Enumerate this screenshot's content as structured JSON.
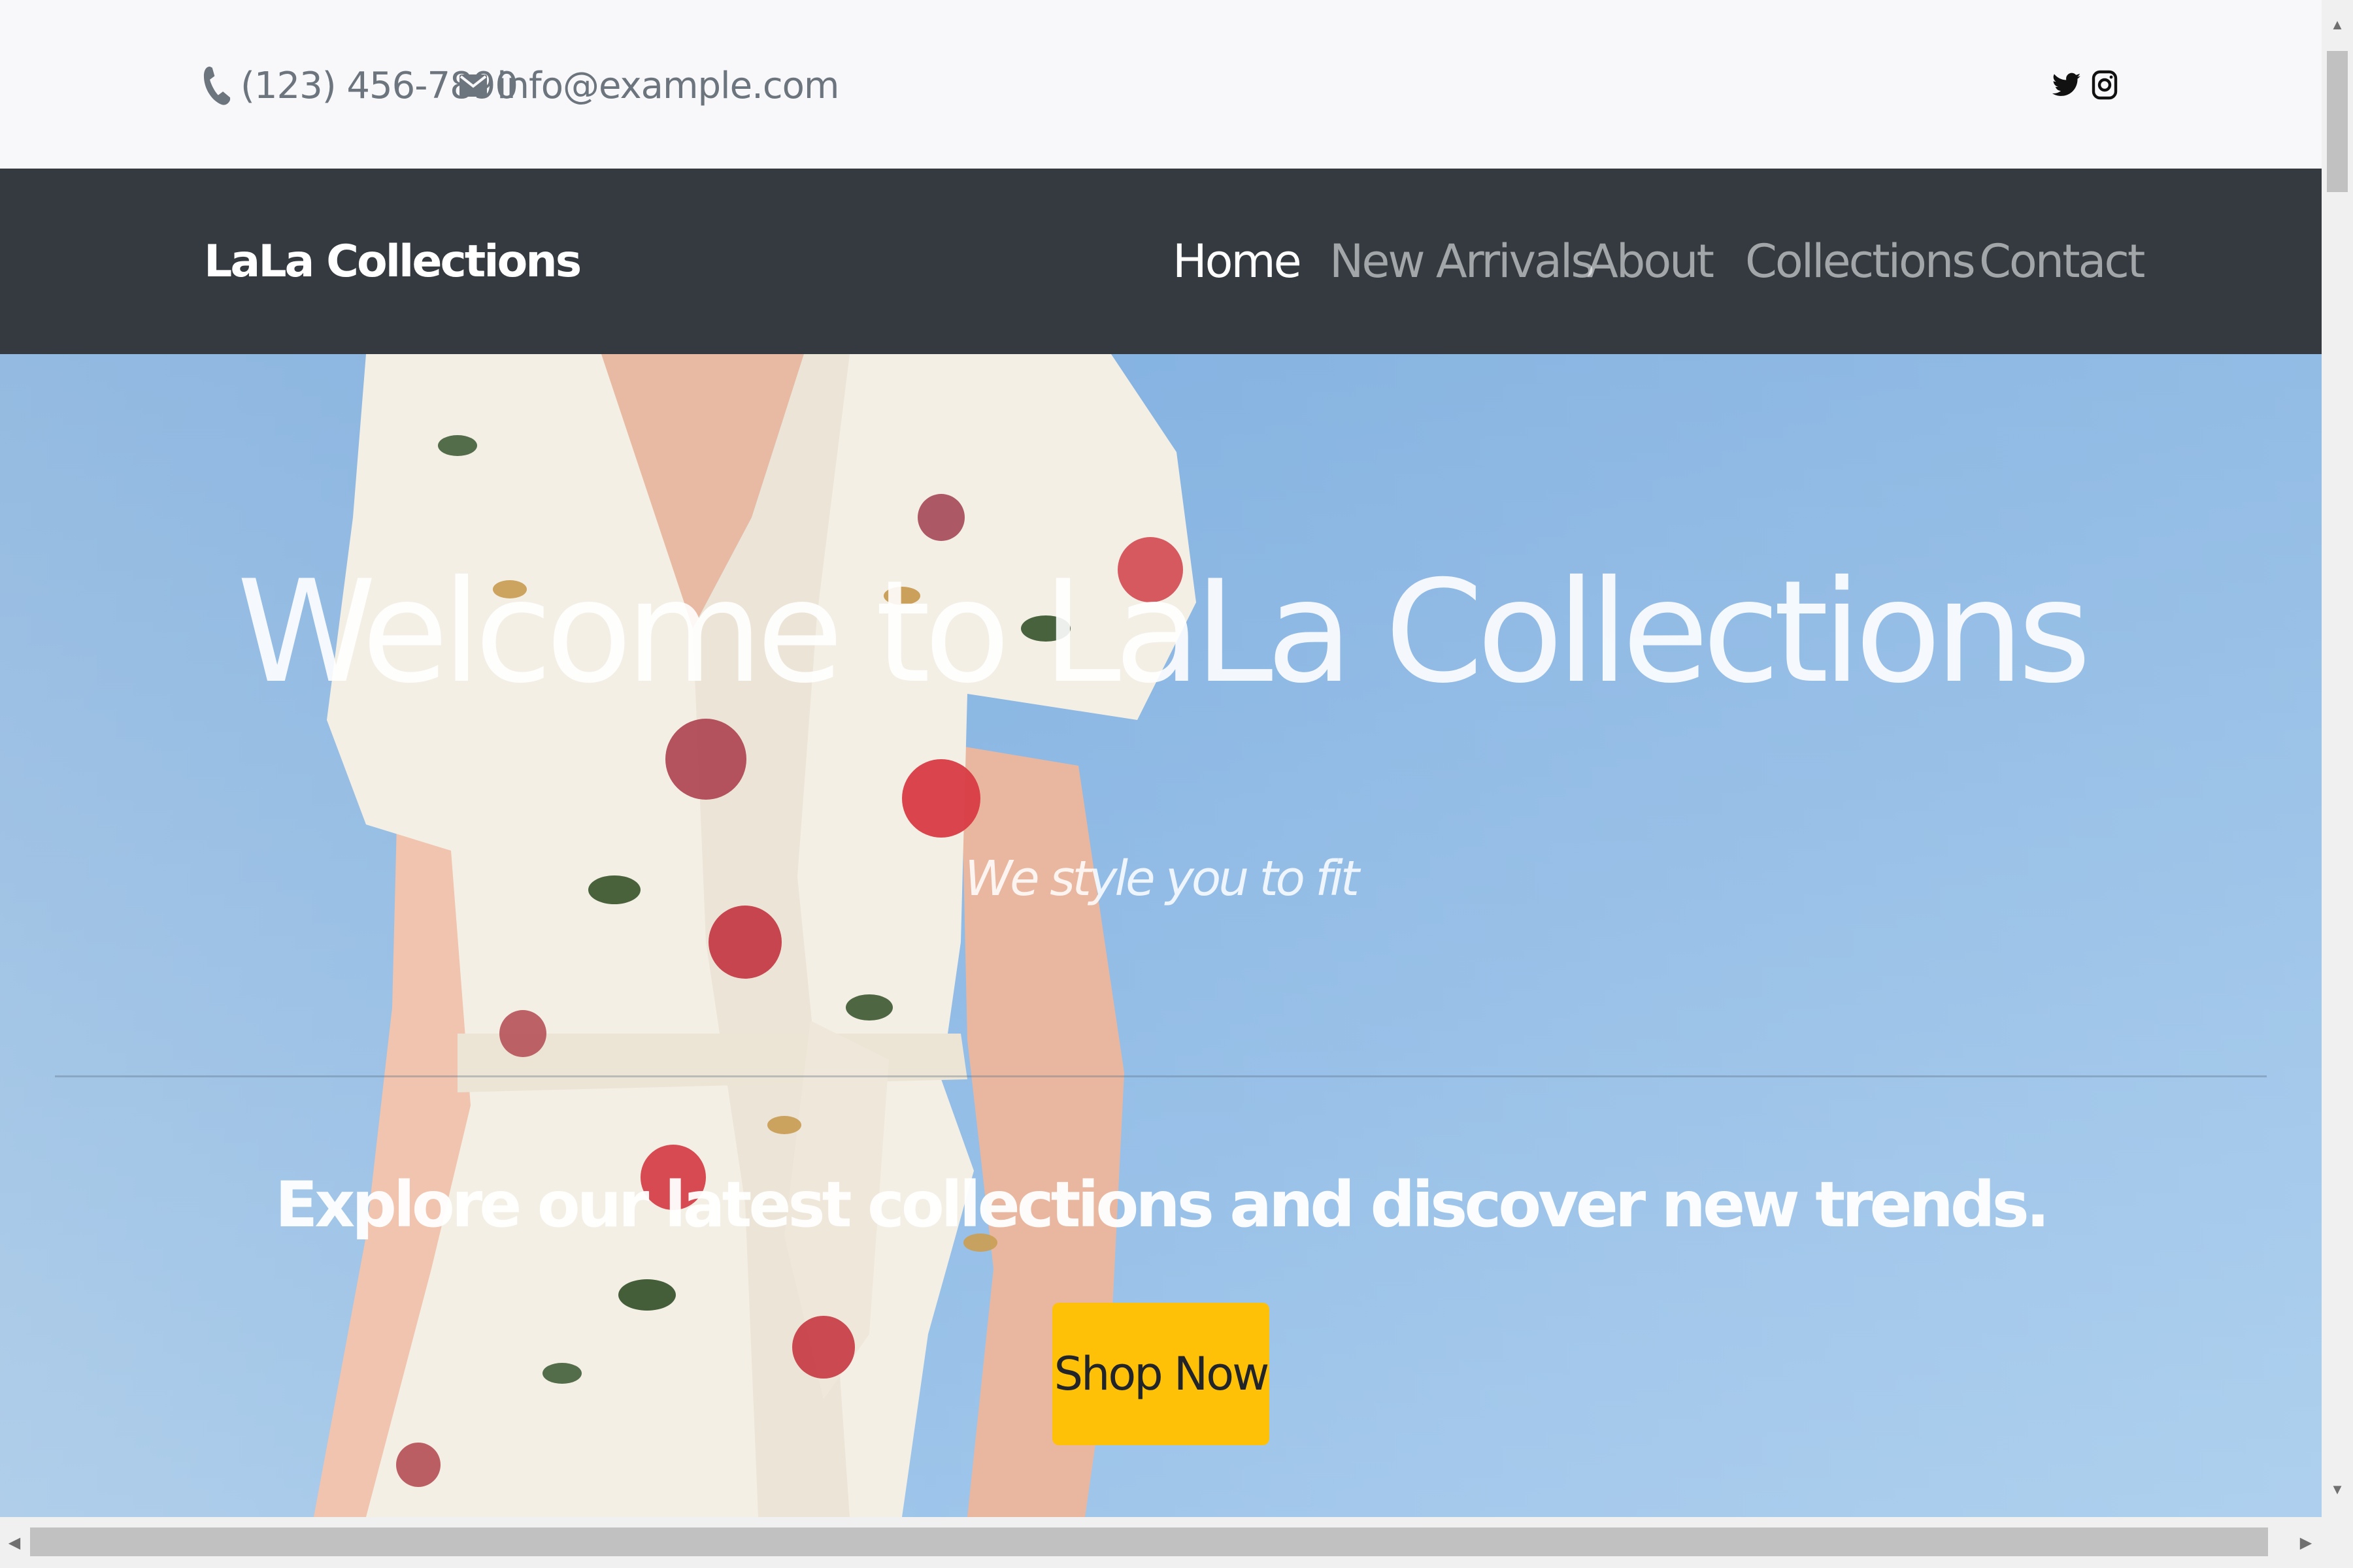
{
  "topbar": {
    "phone": {
      "icon": "phone-icon",
      "text": "(123) 456-7890"
    },
    "email": {
      "icon": "envelope-icon",
      "text": "info@example.com"
    },
    "social": [
      {
        "name": "twitter",
        "icon": "twitter-icon"
      },
      {
        "name": "instagram",
        "icon": "instagram-icon"
      }
    ]
  },
  "navbar": {
    "brand": "LaLa Collections",
    "items": [
      {
        "label": "Home",
        "active": true
      },
      {
        "label": "New Arrivals",
        "active": false
      },
      {
        "label": "About",
        "active": false
      },
      {
        "label": "Collections",
        "active": false
      },
      {
        "label": "Contact",
        "active": false
      }
    ]
  },
  "hero": {
    "title": "Welcome to LaLa Collections",
    "subtitle": "We style you to fit",
    "lead": "Explore our latest collections and discover new trends.",
    "cta_label": "Shop Now"
  },
  "colors": {
    "topbar_bg": "#f8f8fa",
    "navbar_bg": "#343a40",
    "cta_bg": "#ffc107",
    "sky": "#9cc3e9"
  }
}
